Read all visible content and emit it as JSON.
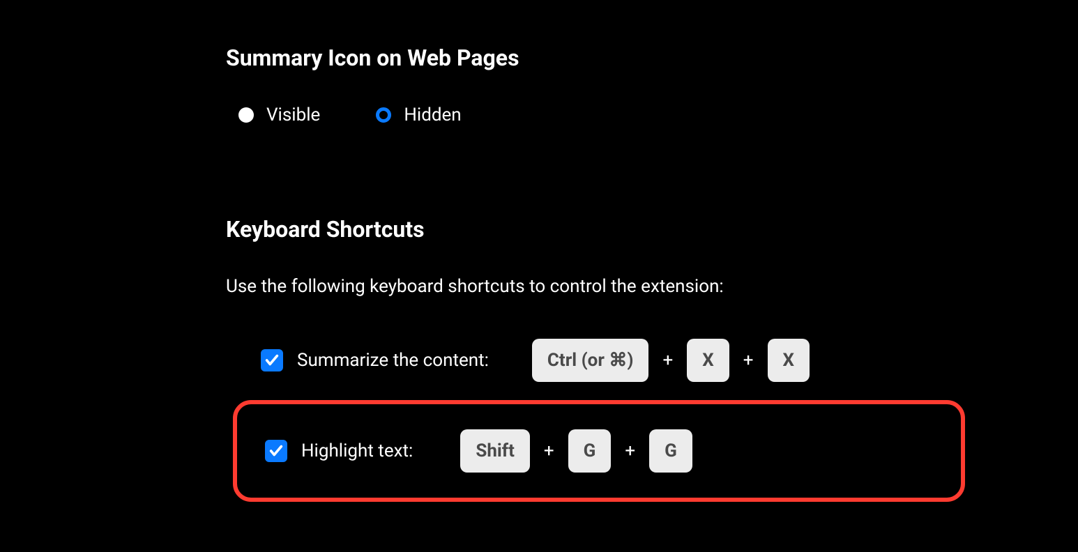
{
  "section1": {
    "title": "Summary Icon on Web Pages",
    "options": [
      {
        "label": "Visible",
        "selected": false
      },
      {
        "label": "Hidden",
        "selected": true
      }
    ]
  },
  "section2": {
    "title": "Keyboard Shortcuts",
    "subtitle": "Use the following keyboard shortcuts to control the extension:",
    "shortcuts": [
      {
        "label": "Summarize the content:",
        "checked": true,
        "keys": [
          "Ctrl (or ⌘)",
          "X",
          "X"
        ]
      },
      {
        "label": "Highlight text:",
        "checked": true,
        "keys": [
          "Shift",
          "G",
          "G"
        ]
      }
    ],
    "separator": "+"
  }
}
